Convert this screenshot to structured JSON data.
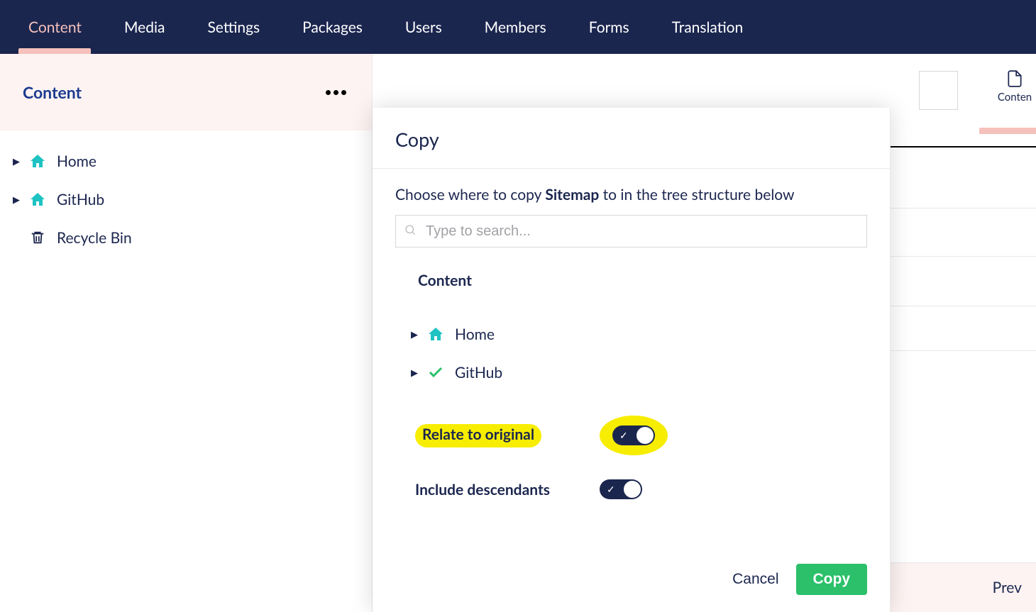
{
  "nav": {
    "items": [
      "Content",
      "Media",
      "Settings",
      "Packages",
      "Users",
      "Members",
      "Forms",
      "Translation"
    ],
    "active": "Content"
  },
  "sidebar": {
    "title": "Content",
    "tree": [
      {
        "label": "Home",
        "icon": "home",
        "expandable": true
      },
      {
        "label": "GitHub",
        "icon": "home",
        "expandable": true
      },
      {
        "label": "Recycle Bin",
        "icon": "trash",
        "expandable": false
      }
    ]
  },
  "dialog": {
    "title": "Copy",
    "choose_prefix": "Choose where to copy ",
    "choose_item": "Sitemap",
    "choose_suffix": " to in the tree structure below",
    "search_placeholder": "Type to search...",
    "tree_title": "Content",
    "tree": [
      {
        "label": "Home",
        "icon": "home",
        "expandable": true
      },
      {
        "label": "GitHub",
        "icon": "check",
        "expandable": true
      }
    ],
    "toggles": {
      "relate_label": "Relate to original",
      "relate_on": true,
      "relate_highlighted": true,
      "descendants_label": "Include descendants",
      "descendants_on": true
    },
    "cancel_label": "Cancel",
    "copy_label": "Copy"
  },
  "editor_back": {
    "info_tab": "Conten",
    "footer_label": "Prev"
  }
}
